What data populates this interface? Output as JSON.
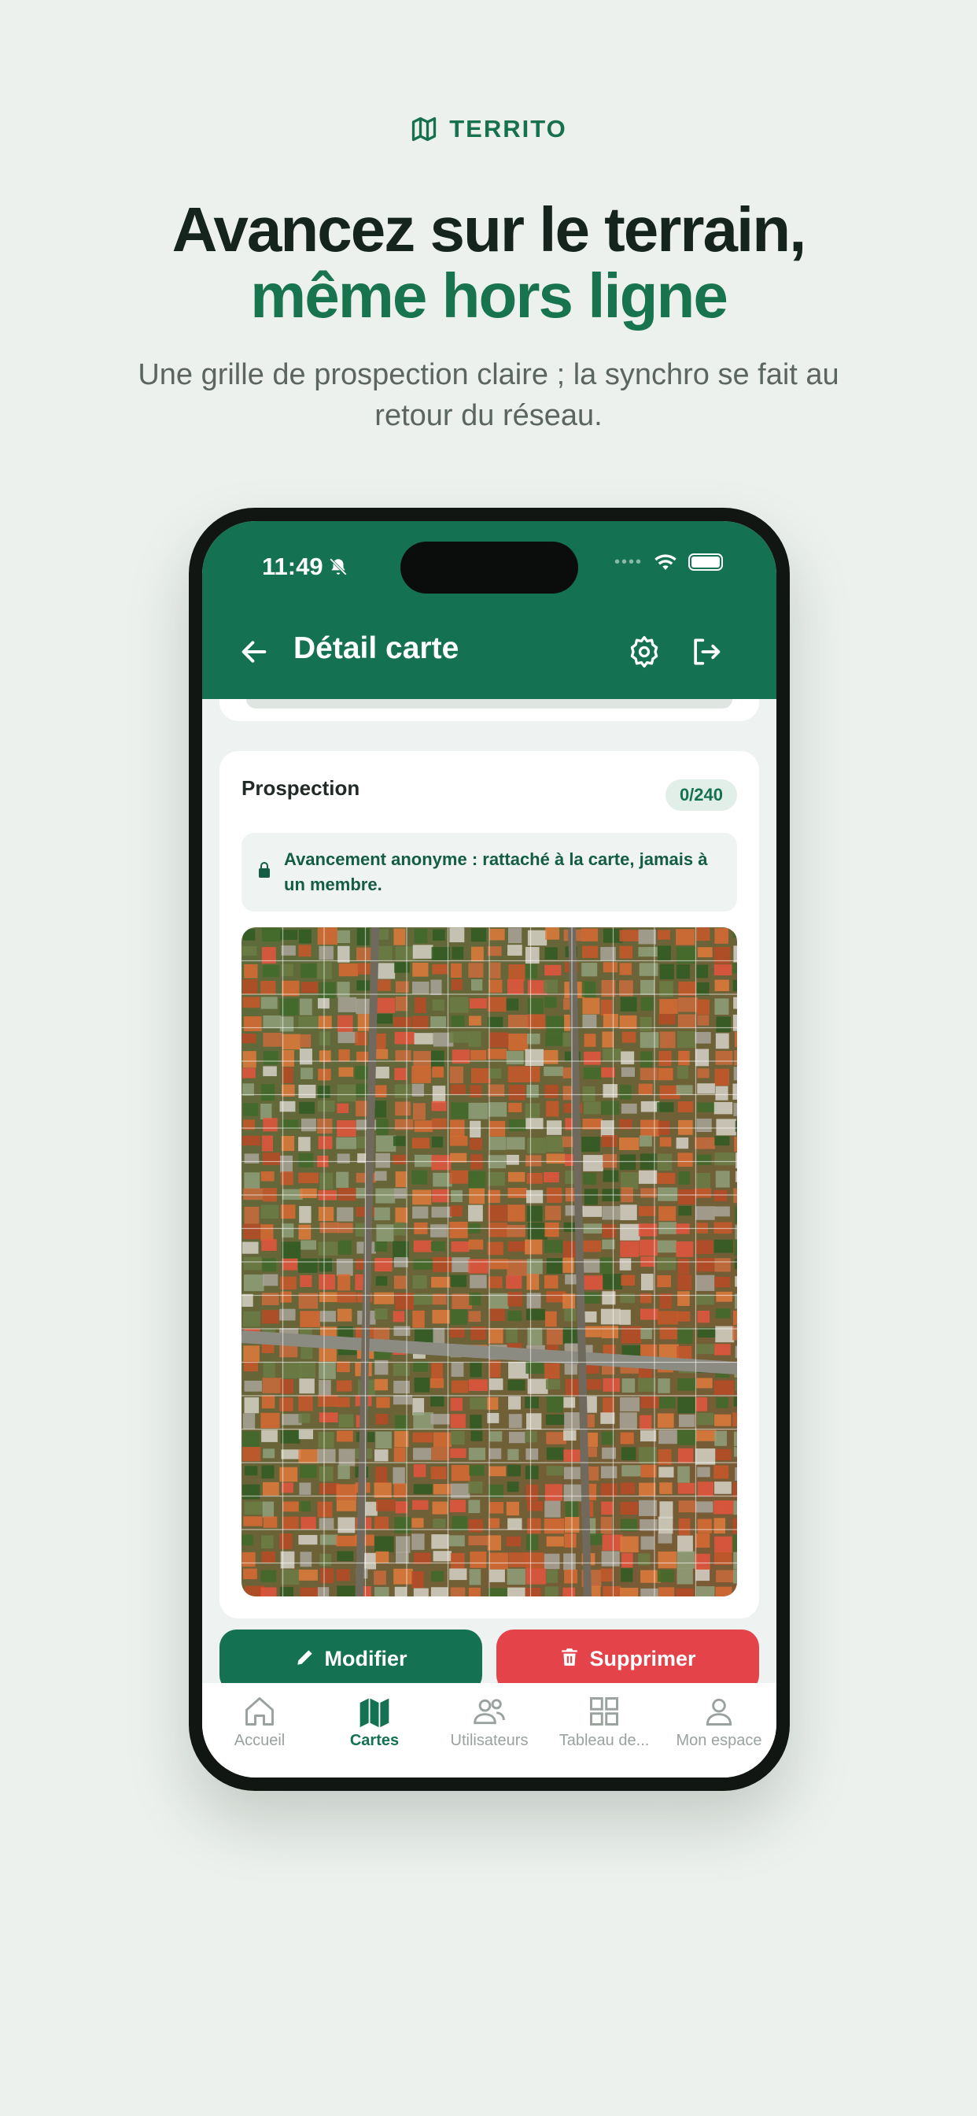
{
  "brand": {
    "icon": "map-icon",
    "name": "TERRITO"
  },
  "headline": {
    "line1": "Avancez sur le terrain,",
    "line2": "même hors ligne"
  },
  "subhead": "Une grille de prospection claire ; la synchro se fait au retour du réseau.",
  "status_bar": {
    "time": "11:49",
    "icons": [
      "bell-slash-icon",
      "wifi-icon",
      "battery-icon"
    ]
  },
  "nav": {
    "title": "Détail carte",
    "icons": [
      "back-arrow-icon",
      "gear-icon",
      "logout-icon"
    ]
  },
  "prospection": {
    "title": "Prospection",
    "count": "0/240",
    "notice": "Avancement anonyme : rattaché à la carte, jamais à un membre.",
    "notice_icon": "lock-icon"
  },
  "actions": {
    "edit": "Modifier",
    "delete": "Supprimer"
  },
  "tabs": [
    {
      "label": "Accueil",
      "icon": "home-icon",
      "active": false
    },
    {
      "label": "Cartes",
      "icon": "map-icon",
      "active": true
    },
    {
      "label": "Utilisateurs",
      "icon": "users-icon",
      "active": false
    },
    {
      "label": "Tableau de...",
      "icon": "dashboard-icon",
      "active": false
    },
    {
      "label": "Mon espace",
      "icon": "person-icon",
      "active": false
    }
  ],
  "colors": {
    "primary": "#147152",
    "danger": "#e4434a",
    "background": "#ecf1ed"
  }
}
